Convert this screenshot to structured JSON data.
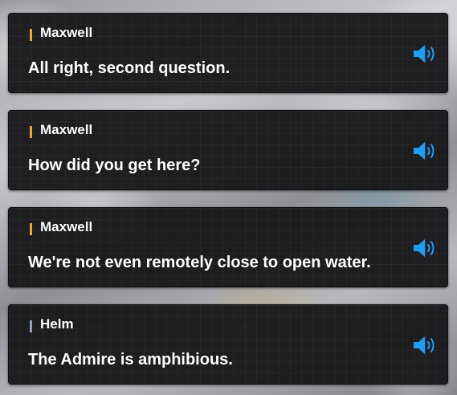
{
  "dialogue": [
    {
      "speaker": "Maxwell",
      "text": "All right, second question.",
      "marker_color": "#f5a623"
    },
    {
      "speaker": "Maxwell",
      "text": "How did you get here?",
      "marker_color": "#f5a623"
    },
    {
      "speaker": "Maxwell",
      "text": "We're not even remotely close to open water.",
      "marker_color": "#f5a623"
    },
    {
      "speaker": "Helm",
      "text": "The Admire is amphibious.",
      "marker_color": "#8fa3c8"
    }
  ],
  "voice_icon": "speaker-volume-icon",
  "voice_icon_color": "#1e9ef0"
}
